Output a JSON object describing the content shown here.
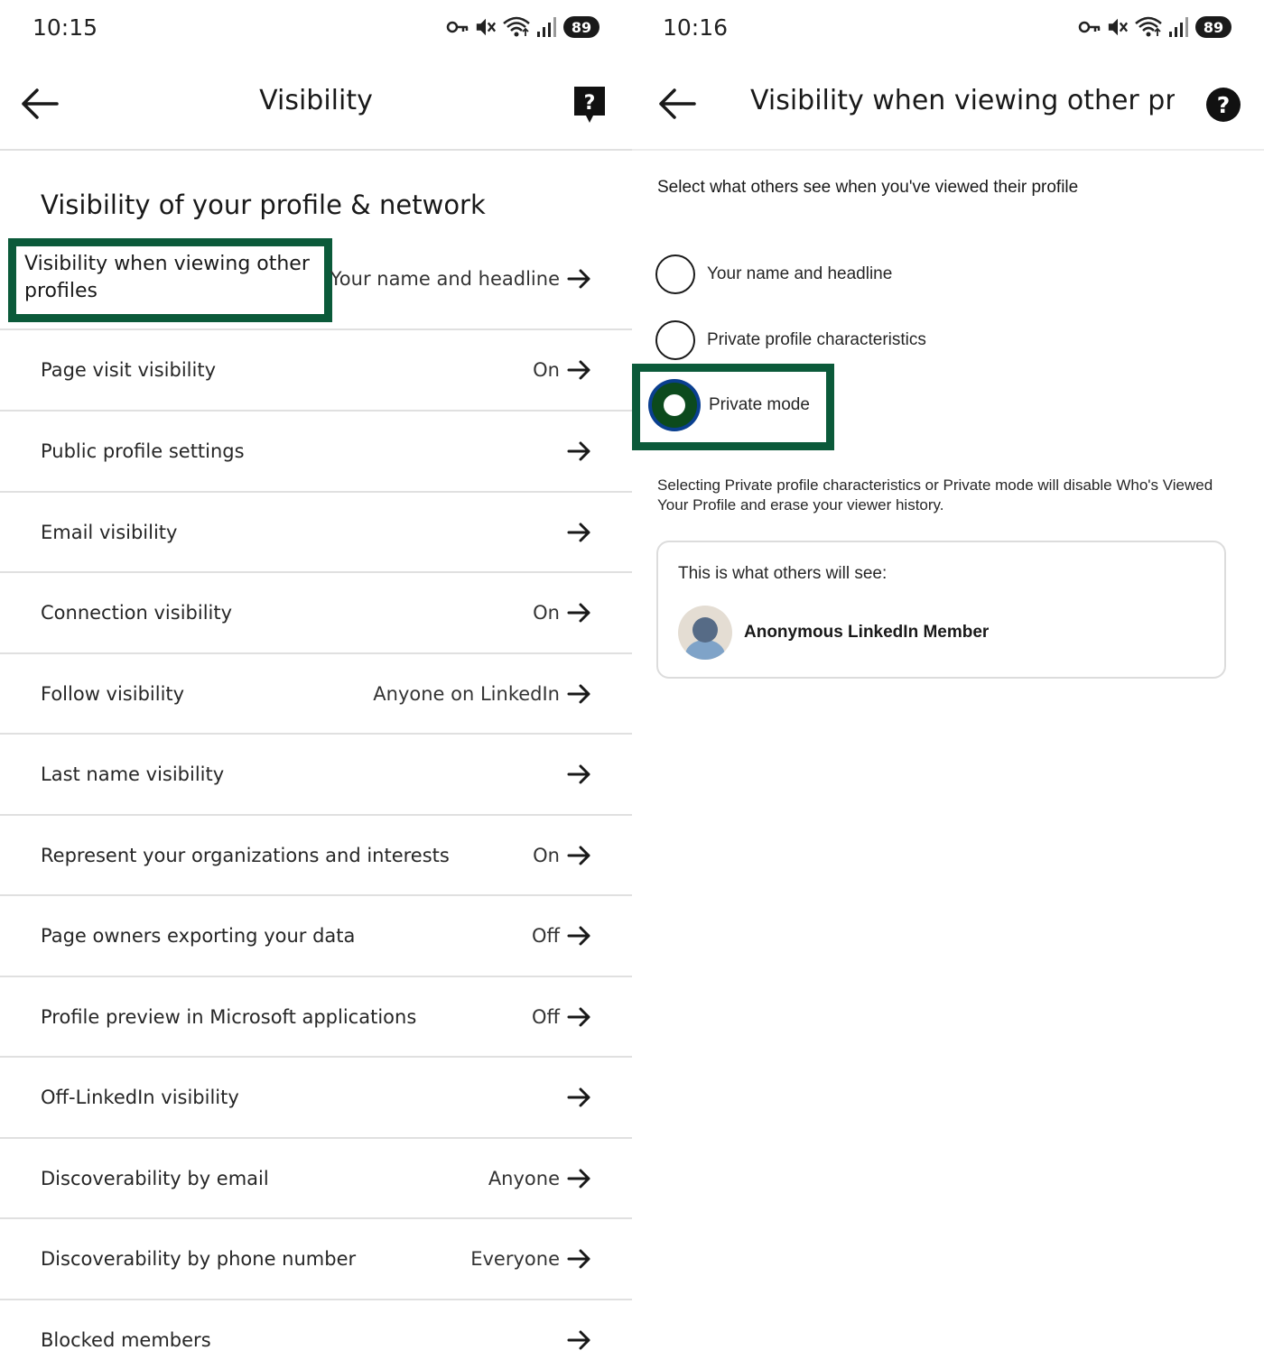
{
  "left": {
    "status": {
      "time": "10:15",
      "battery": "89"
    },
    "header": {
      "title": "Visibility"
    },
    "section_title": "Visibility of your profile & network",
    "rows": [
      {
        "label": "Visibility when viewing other profiles",
        "value": "Your name and headline"
      },
      {
        "label": "Page visit visibility",
        "value": "On"
      },
      {
        "label": "Public profile settings",
        "value": ""
      },
      {
        "label": "Email visibility",
        "value": ""
      },
      {
        "label": "Connection visibility",
        "value": "On"
      },
      {
        "label": "Follow visibility",
        "value": "Anyone on LinkedIn"
      },
      {
        "label": "Last name visibility",
        "value": ""
      },
      {
        "label": "Represent your organizations and interests",
        "value": "On"
      },
      {
        "label": "Page owners exporting your data",
        "value": "Off"
      },
      {
        "label": "Profile preview in Microsoft applications",
        "value": "Off"
      },
      {
        "label": "Off-LinkedIn visibility",
        "value": ""
      },
      {
        "label": "Discoverability by email",
        "value": "Anyone"
      },
      {
        "label": "Discoverability by phone number",
        "value": "Everyone"
      },
      {
        "label": "Blocked members",
        "value": ""
      }
    ]
  },
  "right": {
    "status": {
      "time": "10:16",
      "battery": "89"
    },
    "header": {
      "title": "Visibility when viewing other profi..."
    },
    "subtitle": "Select what others see when you've viewed their profile",
    "options": [
      {
        "label": "Your name and headline",
        "selected": false
      },
      {
        "label": "Private profile characteristics",
        "selected": false
      },
      {
        "label": "Private mode",
        "selected": true
      }
    ],
    "note": "Selecting Private profile characteristics or Private mode will disable Who's Viewed Your Profile and erase your viewer history.",
    "preview": {
      "heading": "This is what others will see:",
      "member_name": "Anonymous LinkedIn Member"
    }
  },
  "icons": {
    "back": "arrow-left-icon",
    "help_left": "help-chat-icon",
    "help_right": "help-circle-icon",
    "row_arrow": "arrow-right-icon",
    "status": [
      "key-icon",
      "mute-icon",
      "wifi-icon",
      "signal-icon"
    ]
  },
  "colors": {
    "highlight": "#0b5a3a",
    "radio_selected_outer": "#0a3f8f",
    "radio_selected_inner": "#0c4a1d",
    "divider": "#e0e0e0"
  }
}
